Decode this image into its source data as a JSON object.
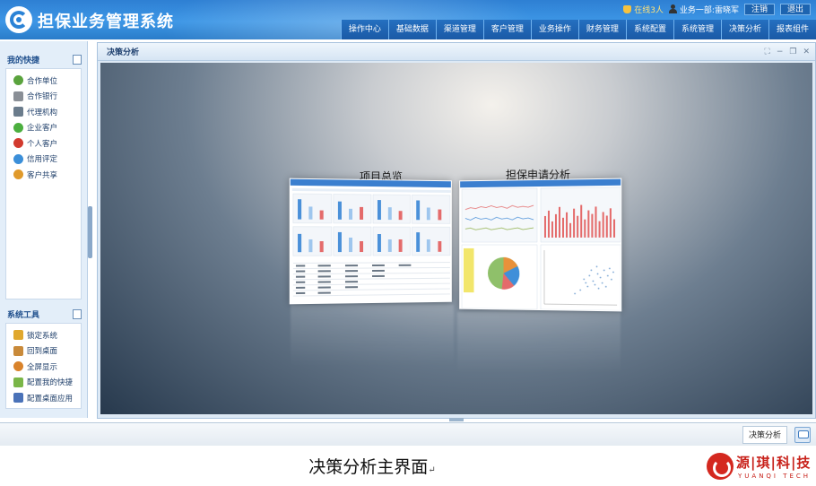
{
  "app": {
    "title": "担保业务管理系统"
  },
  "header": {
    "online_label": "在线3人",
    "user_label": "业务一部:雷晓军",
    "logout_label": "注销",
    "exit_label": "退出"
  },
  "nav": {
    "items": [
      "操作中心",
      "基础数据",
      "渠道管理",
      "客户管理",
      "业务操作",
      "财务管理",
      "系统配置",
      "系统管理",
      "决策分析",
      "报表组件"
    ]
  },
  "sidebar": {
    "quick_title": "我的快捷",
    "quick_items": [
      {
        "label": "合作单位",
        "icon": "partner-icon",
        "color": "#5aa33d"
      },
      {
        "label": "合作银行",
        "icon": "bank-icon",
        "color": "#8a8f96"
      },
      {
        "label": "代理机构",
        "icon": "agency-icon",
        "color": "#6b7c8c"
      },
      {
        "label": "企业客户",
        "icon": "enterprise-icon",
        "color": "#4caf3f"
      },
      {
        "label": "个人客户",
        "icon": "person-icon",
        "color": "#d23a2e"
      },
      {
        "label": "信用评定",
        "icon": "credit-icon",
        "color": "#3b8fd9"
      },
      {
        "label": "客户共享",
        "icon": "share-icon",
        "color": "#e09a2b"
      }
    ],
    "tools_title": "系统工具",
    "tool_items": [
      {
        "label": "锁定系统",
        "icon": "lock-icon",
        "color": "#e0a82e"
      },
      {
        "label": "回到桌面",
        "icon": "desktop-icon",
        "color": "#c98a3a"
      },
      {
        "label": "全屏显示",
        "icon": "fullscreen-icon",
        "color": "#d9832b"
      },
      {
        "label": "配置我的快捷",
        "icon": "config-shortcut-icon",
        "color": "#7ab648"
      },
      {
        "label": "配置桌面应用",
        "icon": "config-desktop-icon",
        "color": "#4a72b8"
      }
    ]
  },
  "panel": {
    "title": "决策分析",
    "cards": [
      {
        "label": "项目总览"
      },
      {
        "label": "担保申请分析"
      }
    ]
  },
  "status_bar": {
    "active_tab": "决策分析"
  },
  "caption": {
    "text": "决策分析主界面",
    "return_mark": "↵"
  },
  "brand": {
    "name": "源|琪|科|技",
    "sub": "YUANQI TECH"
  },
  "colors": {
    "header": "#2e7fd3",
    "accent_red": "#d4281f",
    "bar_blue": "#4a90d9",
    "bar_red": "#e46b6b"
  }
}
